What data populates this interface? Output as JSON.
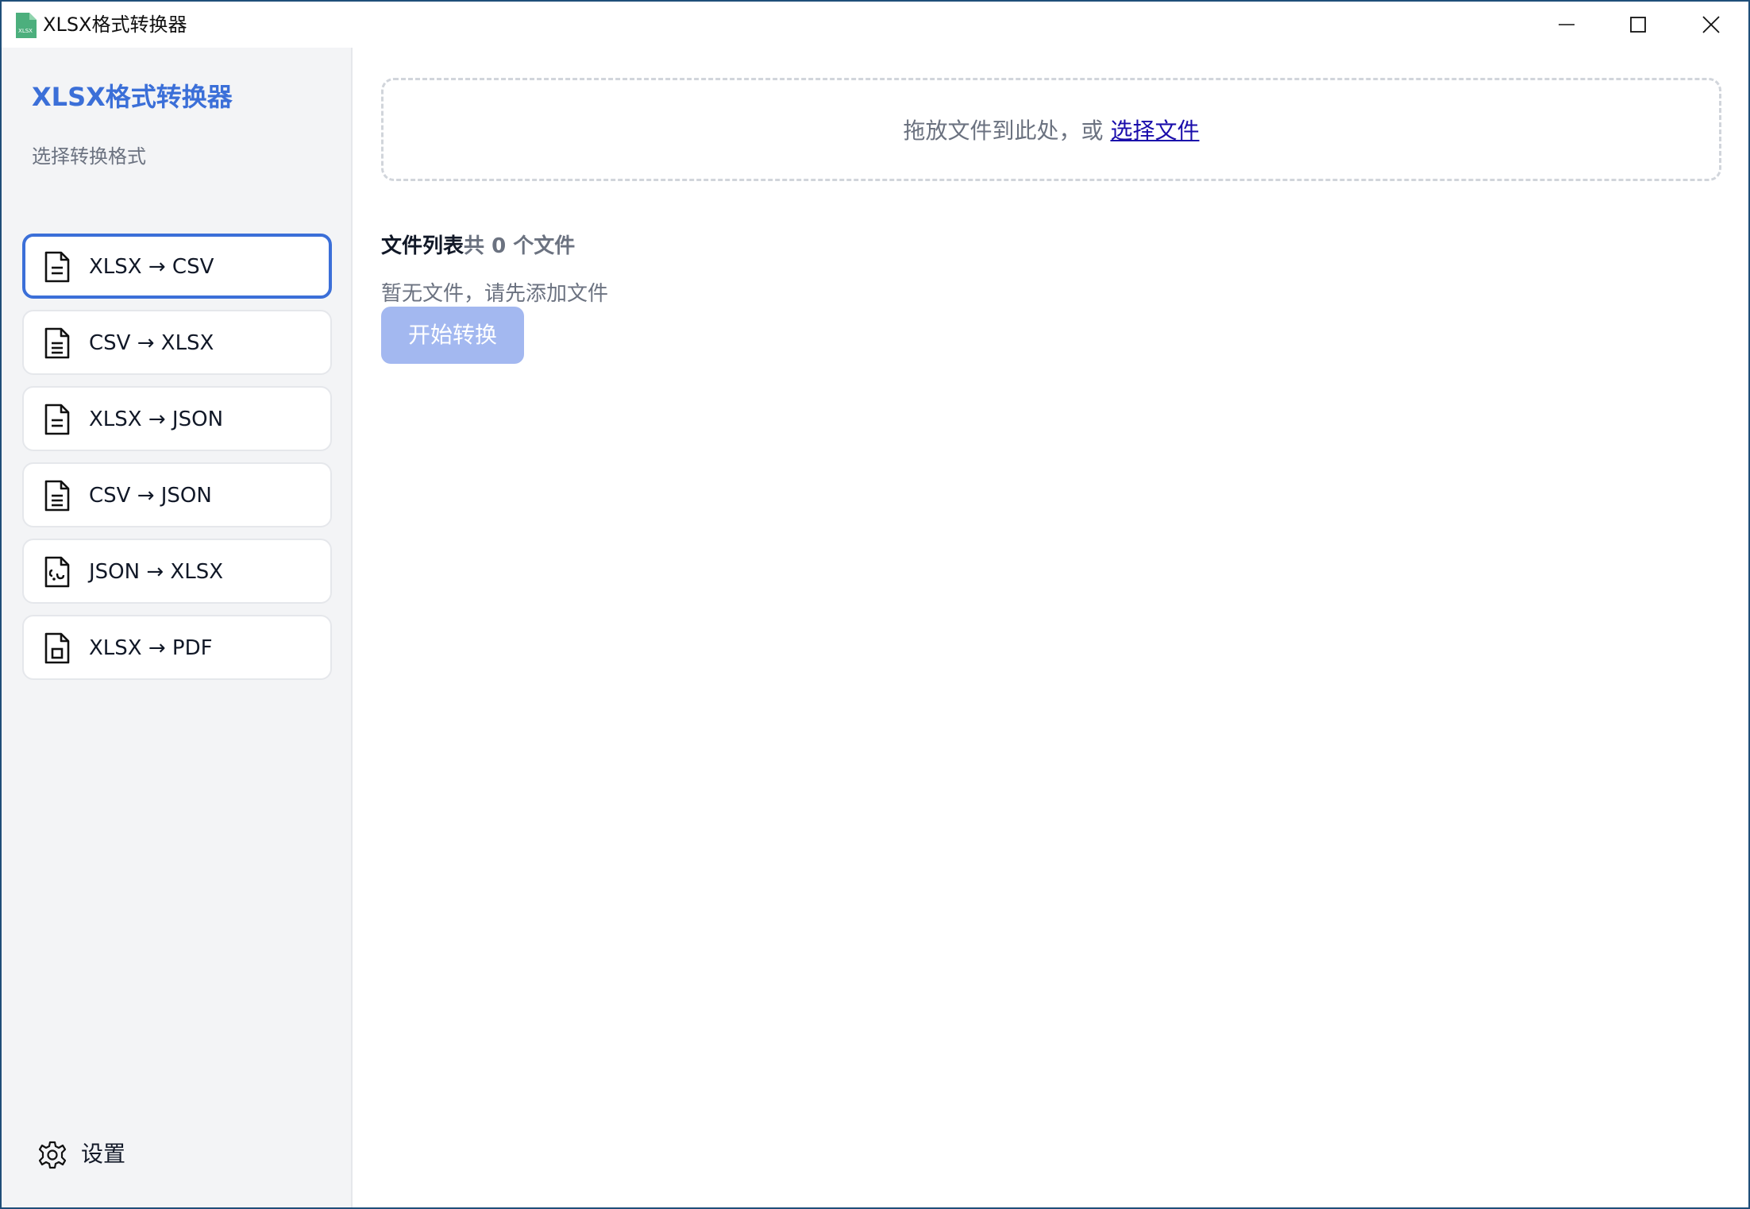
{
  "window": {
    "title": "XLSX格式转换器",
    "icon_text": "XLSX",
    "controls": [
      "minimize-icon",
      "maximize-icon",
      "close-icon"
    ]
  },
  "sidebar": {
    "title": "XLSX格式转换器",
    "subtitle": "选择转换格式",
    "formats": [
      {
        "label": "XLSX → CSV",
        "icon": "file-text-icon",
        "active": true
      },
      {
        "label": "CSV → XLSX",
        "icon": "file-text-icon",
        "active": false
      },
      {
        "label": "XLSX → JSON",
        "icon": "file-text-icon",
        "active": false
      },
      {
        "label": "CSV → JSON",
        "icon": "file-text-icon",
        "active": false
      },
      {
        "label": "JSON → XLSX",
        "icon": "file-code-icon",
        "active": false
      },
      {
        "label": "XLSX → PDF",
        "icon": "file-pdf-icon",
        "active": false
      }
    ],
    "settings_label": "设置"
  },
  "main": {
    "dropzone": {
      "text": "拖放文件到此处，或 ",
      "link": "选择文件"
    },
    "file_list": {
      "title": "文件列表",
      "count_text": "共 0 个文件",
      "empty_text": "暂无文件，请先添加文件"
    },
    "start_button": "开始转换"
  },
  "colors": {
    "accent": "#3b6fd8",
    "button_disabled": "#a3b8f0",
    "sidebar_bg": "#f3f4f6",
    "link": "#1a0dab"
  }
}
